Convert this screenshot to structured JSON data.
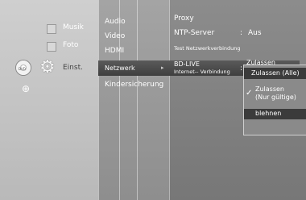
{
  "left_menu": {
    "items": [
      {
        "label": "Musik",
        "icon": "music-icon"
      },
      {
        "label": "Foto",
        "icon": "photo-icon"
      },
      {
        "label": "Einst.",
        "icon": "settings-gear-icon"
      }
    ],
    "disc_label": "DVD"
  },
  "middle_menu": {
    "items": [
      "Audio",
      "Video",
      "HDMI",
      "Netzwerk",
      "Kindersicherung"
    ],
    "selected": "Netzwerk",
    "selected_arrow": "▸"
  },
  "right_menu": {
    "proxy": "Proxy",
    "ntp_label": "NTP-Server",
    "ntp_sep": ":",
    "ntp_value": "Aus",
    "test_label": "Test Netzwerkverbindung",
    "bdlive_label": "BD-LIVE",
    "bdlive_sub": "Internet-- Verbindung",
    "bdlive_sep": ":",
    "bdlive_value_partial": "Zulassen"
  },
  "popup": {
    "options": [
      {
        "label": "Zulassen (Alle)",
        "checked": false,
        "highlighted": true
      },
      {
        "label": "Zulassen (Nur gültige)",
        "line1": "Zulassen",
        "line2": "(Nur gültige)",
        "checked": true,
        "highlighted": false
      },
      {
        "label": "blehnen",
        "checked": false,
        "highlighted": true
      }
    ],
    "check_glyph": "✓"
  }
}
